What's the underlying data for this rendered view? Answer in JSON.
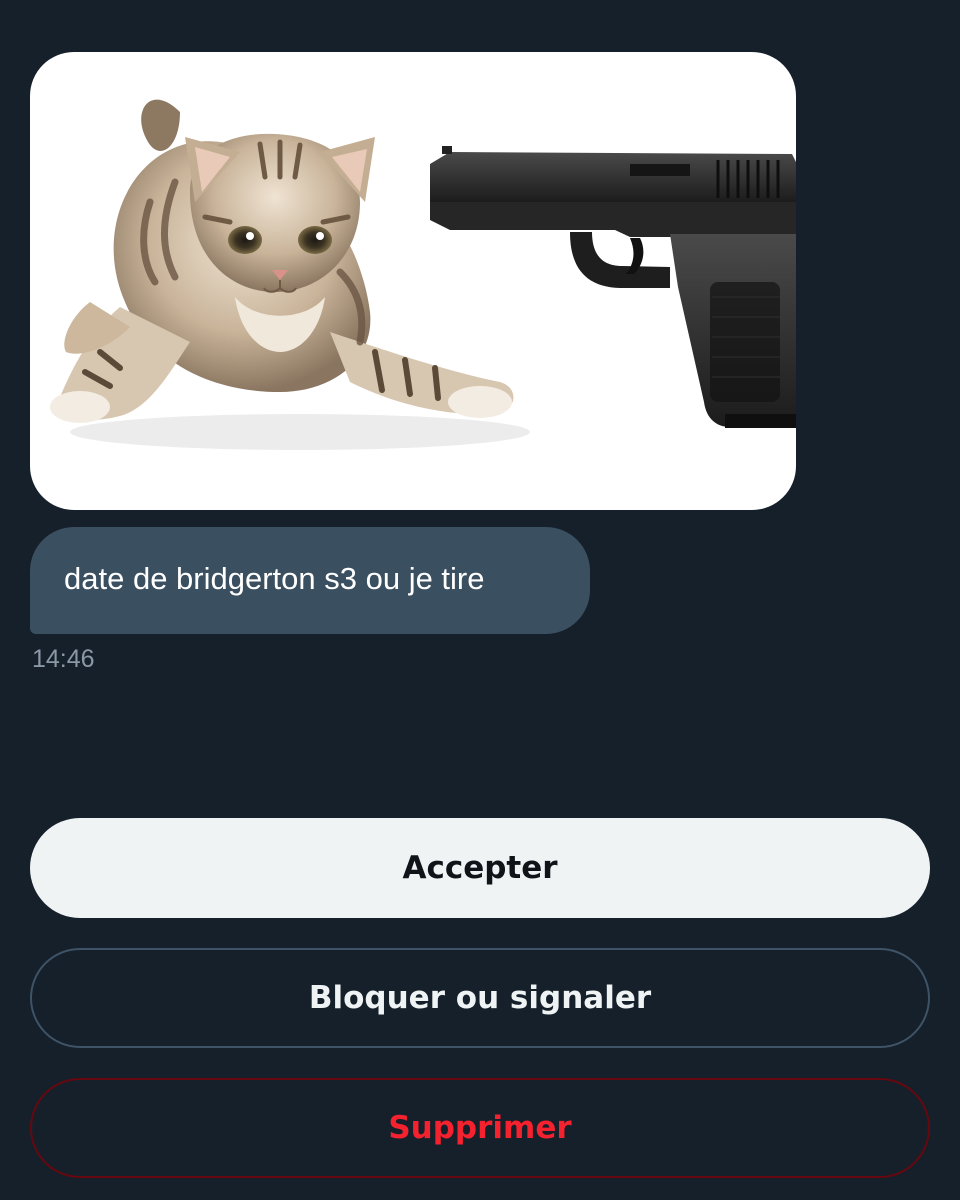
{
  "conversation": {
    "media": {
      "left_subject": "kitten",
      "right_subject": "pistol"
    },
    "message": {
      "text": "date de bridgerton s3 ou je tire",
      "time": "14:46"
    }
  },
  "actions": {
    "accept_label": "Accepter",
    "block_label": "Bloquer ou signaler",
    "delete_label": "Supprimer"
  },
  "colors": {
    "background": "#15202b",
    "bubble": "#3a4f60",
    "accept_bg": "#eff3f4",
    "delete_text": "#f4212e"
  }
}
